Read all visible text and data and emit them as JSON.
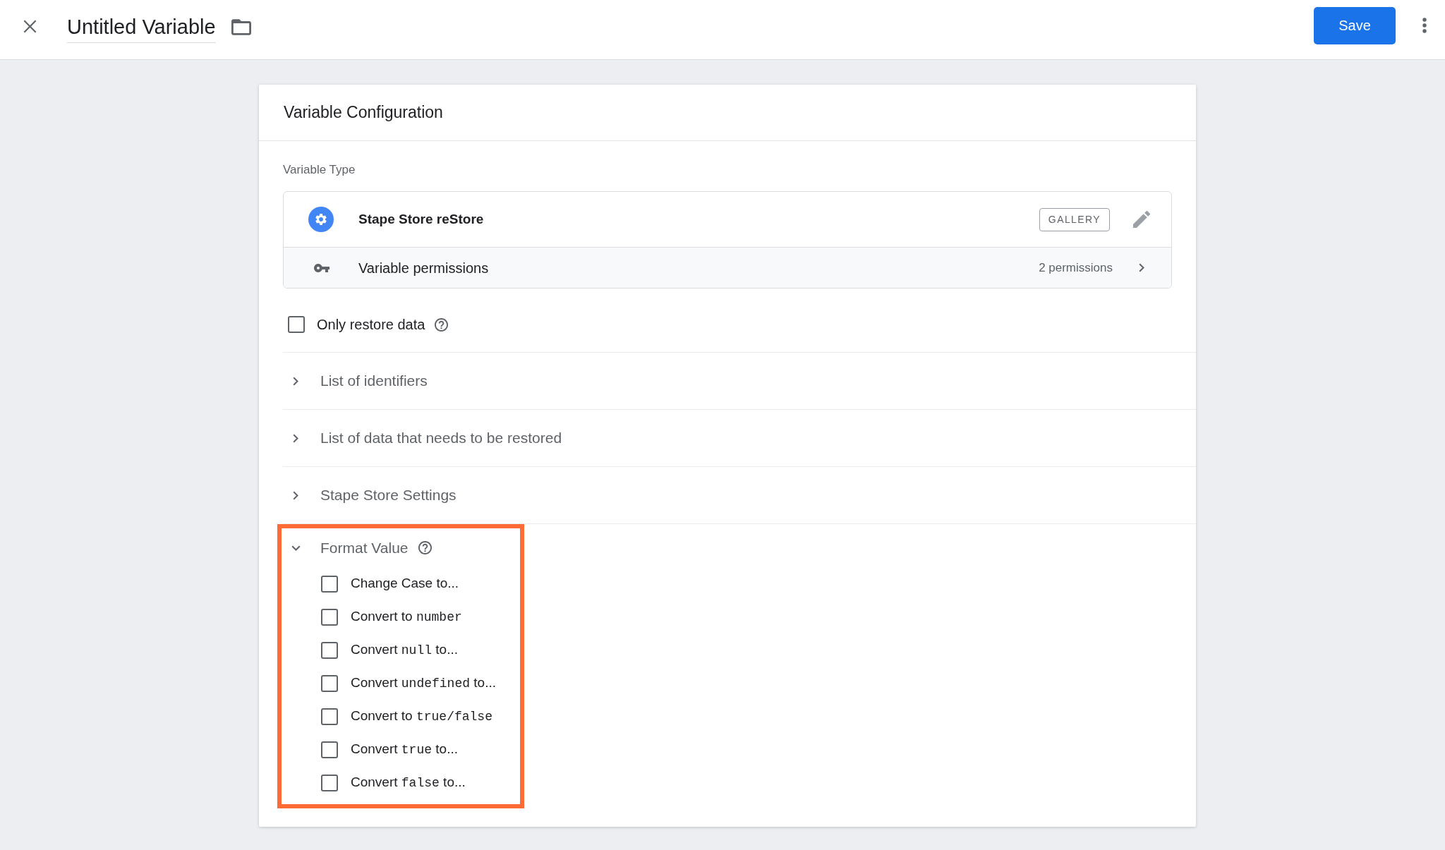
{
  "top_bar": {
    "title": "Untitled Variable",
    "save_button": "Save"
  },
  "card": {
    "title": "Variable Configuration",
    "variable_type": {
      "label": "Variable Type",
      "name": "Stape Store reStore",
      "tag": "GALLERY",
      "permissions": {
        "label": "Variable permissions",
        "count": "2 permissions"
      }
    },
    "options": [
      {
        "label": "Only restore data",
        "checked": false,
        "help": true
      }
    ],
    "sections": [
      {
        "title": "List of identifiers",
        "expanded": false,
        "help": false,
        "highlighted": false
      },
      {
        "title": "List of data that needs to be restored",
        "expanded": false,
        "help": false,
        "highlighted": false
      },
      {
        "title": "Stape Store Settings",
        "expanded": false,
        "help": false,
        "highlighted": false
      },
      {
        "title": "Format Value",
        "expanded": true,
        "help": true,
        "highlighted": true,
        "items": [
          {
            "checked": false,
            "label_parts": [
              {
                "kind": "plain",
                "text": "Change Case to..."
              }
            ]
          },
          {
            "checked": false,
            "label_parts": [
              {
                "kind": "plain",
                "text": "Convert to "
              },
              {
                "kind": "code",
                "text": "number"
              }
            ]
          },
          {
            "checked": false,
            "label_parts": [
              {
                "kind": "plain",
                "text": "Convert "
              },
              {
                "kind": "code",
                "text": "null"
              },
              {
                "kind": "plain",
                "text": " to..."
              }
            ]
          },
          {
            "checked": false,
            "label_parts": [
              {
                "kind": "plain",
                "text": "Convert "
              },
              {
                "kind": "code",
                "text": "undefined"
              },
              {
                "kind": "plain",
                "text": " to..."
              }
            ]
          },
          {
            "checked": false,
            "label_parts": [
              {
                "kind": "plain",
                "text": "Convert to "
              },
              {
                "kind": "code",
                "text": "true/false"
              }
            ]
          },
          {
            "checked": false,
            "label_parts": [
              {
                "kind": "plain",
                "text": "Convert "
              },
              {
                "kind": "code",
                "text": "true"
              },
              {
                "kind": "plain",
                "text": " to..."
              }
            ]
          },
          {
            "checked": false,
            "label_parts": [
              {
                "kind": "plain",
                "text": "Convert "
              },
              {
                "kind": "code",
                "text": "false"
              },
              {
                "kind": "plain",
                "text": " to..."
              }
            ]
          }
        ]
      }
    ]
  }
}
